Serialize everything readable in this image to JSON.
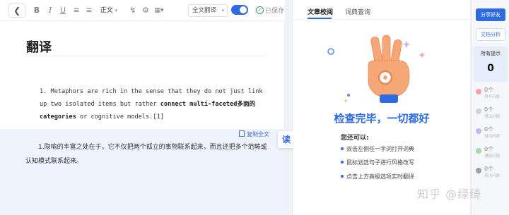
{
  "toolbar": {
    "back_icon": "chevron-left-icon",
    "bold": "B",
    "italic": "I",
    "underline": "U",
    "font_style": "正文",
    "mode_select": "全文翻译",
    "saved": "已保存"
  },
  "document": {
    "title": "翻译",
    "source_parts": [
      "1. Metaphors are rich in the sense that they do not just link up two isolated items but rather ",
      "connect multi-faceted多面的 categories",
      " or cognitive models.[1]"
    ],
    "copy_all": "复制全文",
    "translation": "1.隐喻的丰富之处在于，它不仅把两个孤立的事物联系起来，而且还把多个范畴或认知模式联系起来。"
  },
  "read_button": "读",
  "review": {
    "tabs": [
      "文章校阅",
      "词典查询"
    ],
    "done_title": "检查完毕，一切都好",
    "tips_title": "您还可以:",
    "tips": [
      "双击左侧任一字词打开词典",
      "鼠标划选句子进行风格改写",
      "点击上方高级选项实时翻译"
    ]
  },
  "sidebar": {
    "share": "分享好友",
    "analyze": "文档分析",
    "all_label": "所有提示",
    "all_count": "0",
    "categories": [
      {
        "count": "0个",
        "name": "拼写问题",
        "color": "#f3a5a5"
      },
      {
        "count": "0个",
        "name": "语法问题",
        "color": "#cfd3da"
      },
      {
        "count": "0个",
        "name": "用词问题",
        "color": "#c7b6ee"
      },
      {
        "count": "0个",
        "name": "通顺问题",
        "color": "#a9d8b0"
      },
      {
        "count": "0个",
        "name": "表达问题",
        "color": "#9aa0aa"
      }
    ]
  },
  "watermark": "知乎 @绿绮",
  "colors": {
    "accent": "#2f6bde"
  }
}
